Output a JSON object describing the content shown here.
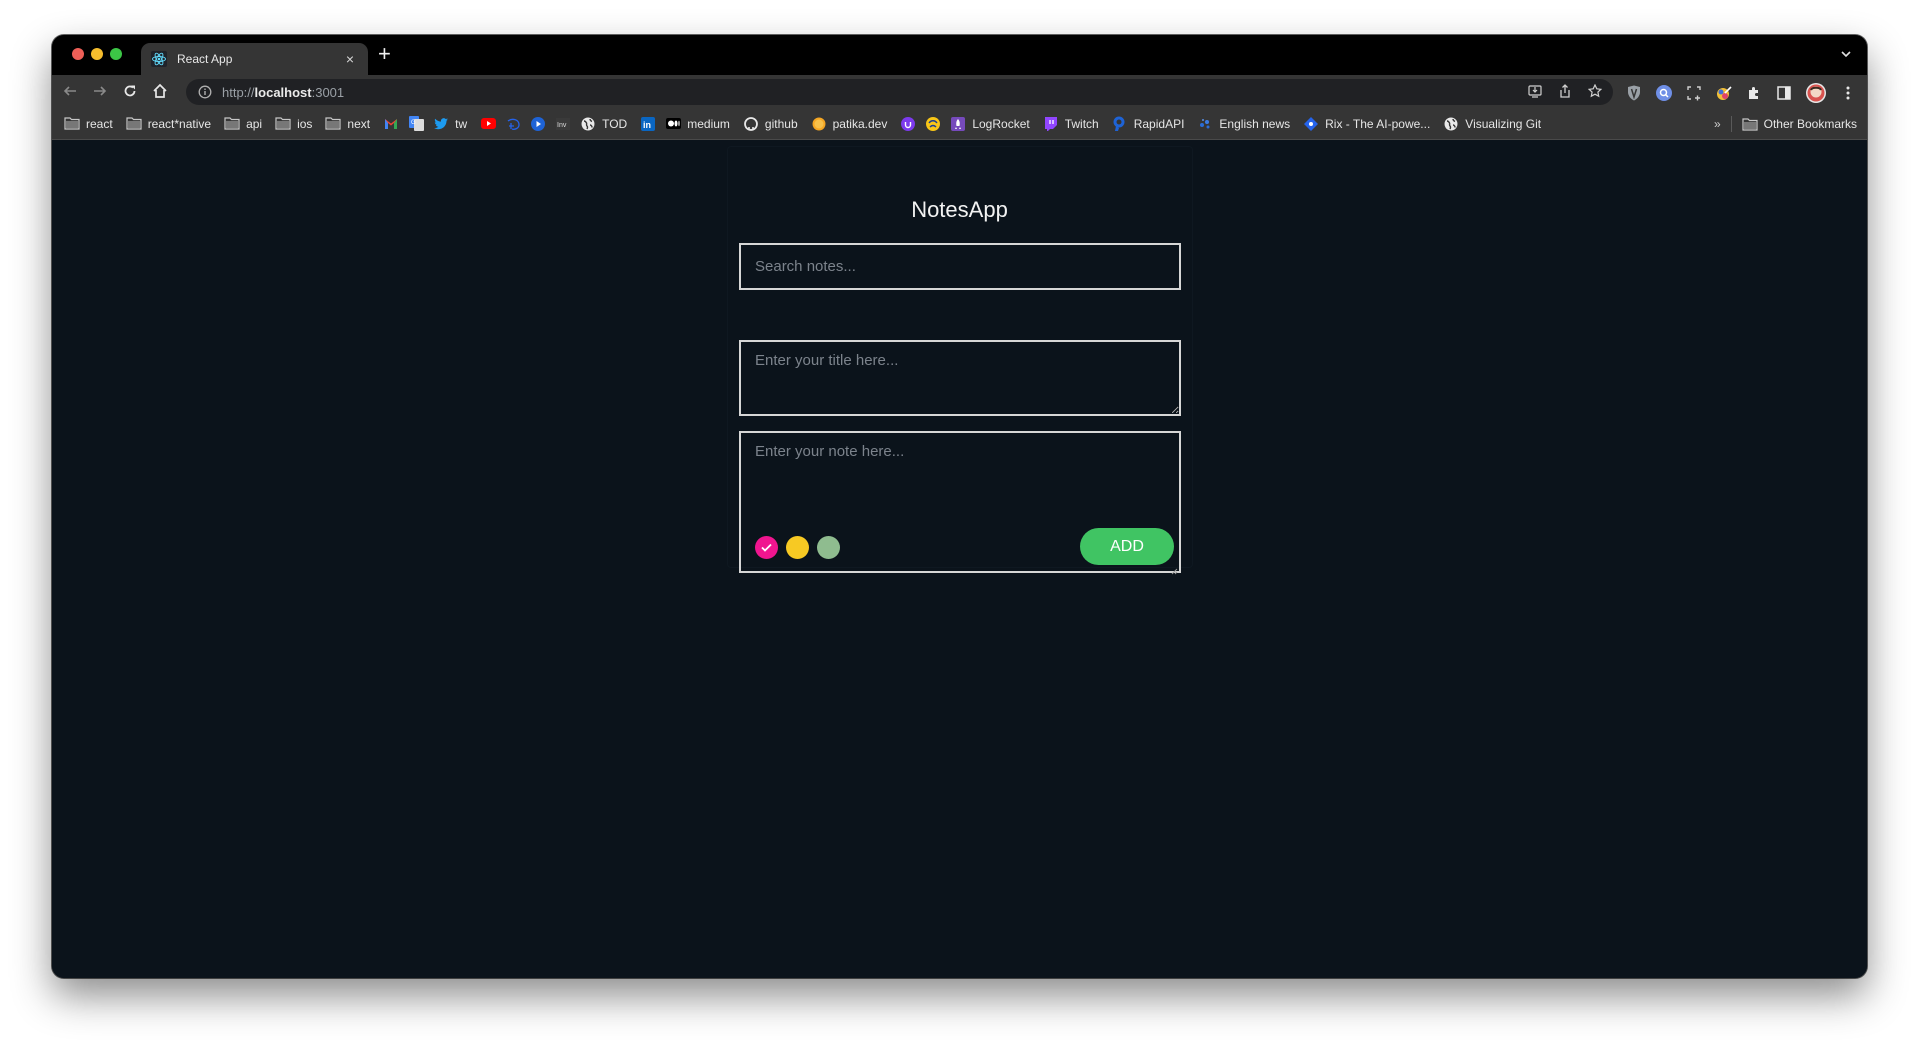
{
  "browser": {
    "tab": {
      "title": "React App",
      "favicon": "react-icon"
    },
    "new_tab_label": "+",
    "tab_close_label": "×",
    "url": {
      "scheme": "http://",
      "host": "localhost",
      "port": ":3001"
    },
    "nav_icons": [
      "back-icon",
      "forward-icon",
      "reload-icon",
      "home-icon"
    ],
    "omnibox_actions": [
      "install-icon",
      "share-icon",
      "bookmark-star-icon"
    ],
    "extensions": [
      "shield-extension-icon",
      "search-extension-icon",
      "screenshot-extension-icon",
      "colorpicker-extension-icon",
      "extensions-puzzle-icon",
      "sidepanel-icon",
      "profile-avatar",
      "menu-kebab-icon"
    ],
    "bookmarks": [
      {
        "label": "react",
        "icon": "folder-icon"
      },
      {
        "label": "react*native",
        "icon": "folder-icon"
      },
      {
        "label": "api",
        "icon": "folder-icon"
      },
      {
        "label": "ios",
        "icon": "folder-icon"
      },
      {
        "label": "next",
        "icon": "folder-icon"
      },
      {
        "label": "",
        "icon": "gmail-icon"
      },
      {
        "label": "",
        "icon": "translate-icon"
      },
      {
        "label": "tw",
        "icon": "twitter-icon"
      },
      {
        "label": "",
        "icon": "youtube-icon"
      },
      {
        "label": "",
        "icon": "disney-icon"
      },
      {
        "label": "",
        "icon": "play-icon"
      },
      {
        "label": "",
        "icon": "inv-icon"
      },
      {
        "label": "TOD",
        "icon": "globe-icon"
      },
      {
        "label": "",
        "icon": "linkedin-icon"
      },
      {
        "label": "medium",
        "icon": "medium-icon"
      },
      {
        "label": "github",
        "icon": "github-icon"
      },
      {
        "label": "patika.dev",
        "icon": "patika-icon"
      },
      {
        "label": "",
        "icon": "ublock-icon"
      },
      {
        "label": "",
        "icon": "turkcell-icon"
      },
      {
        "label": "LogRocket",
        "icon": "logrocket-icon"
      },
      {
        "label": "Twitch",
        "icon": "twitch-icon"
      },
      {
        "label": "RapidAPI",
        "icon": "rapidapi-icon"
      },
      {
        "label": "English news",
        "icon": "news-icon"
      },
      {
        "label": "Rix - The AI-powe...",
        "icon": "rix-icon"
      },
      {
        "label": "Visualizing Git",
        "icon": "globe-icon"
      }
    ],
    "more_bookmarks_label": "»",
    "other_bookmarks_label": "Other Bookmarks"
  },
  "app": {
    "title": "NotesApp",
    "search": {
      "placeholder": "Search notes...",
      "value": ""
    },
    "title_field": {
      "placeholder": "Enter your title here...",
      "value": ""
    },
    "note_field": {
      "placeholder": "Enter your note here...",
      "value": ""
    },
    "colors": [
      {
        "name": "pink",
        "hex": "#f0158f",
        "selected": true
      },
      {
        "name": "yellow",
        "hex": "#f7c923",
        "selected": false
      },
      {
        "name": "green",
        "hex": "#8fbc8f",
        "selected": false
      }
    ],
    "add_button": {
      "label": "ADD",
      "color": "#40c463"
    }
  }
}
